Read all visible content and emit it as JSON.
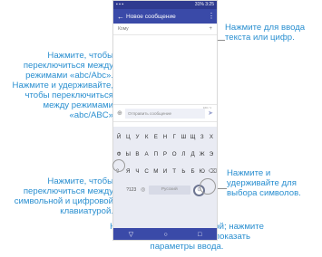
{
  "callouts": {
    "text_input": "Нажмите для ввода текста или цифр.",
    "abc_mode": "Нажмите, чтобы переключиться между режимами «abc/Abc». Нажмите и удерживайте, чтобы переключиться между режимами «abc/ABC»",
    "symbol_keyboard": "Нажмите, чтобы переключиться между символьной и цифровой клавиатурой.",
    "symbols": "Нажмите и удерживайте для выбора символов.",
    "comma": "Нажмите для ввода запятой; нажмите и удерживайте, чтобы показать параметры ввода."
  },
  "phone": {
    "status": {
      "time": "3:25",
      "battery": "31%"
    },
    "appbar": {
      "back_icon": "←",
      "title": "Новое сообщение",
      "menu_icon": "⋮"
    },
    "recipient": {
      "placeholder": "Кому",
      "add_icon": "+"
    },
    "compose": {
      "clip_icon": "⊕",
      "placeholder": "Отправить сообщение",
      "counter": "160 / 1",
      "send_icon": "➤"
    },
    "keyboard": {
      "row1": [
        "Й",
        "Ц",
        "У",
        "К",
        "Е",
        "Н",
        "Г",
        "Ш",
        "Щ",
        "З",
        "Х"
      ],
      "row2": [
        "Ф",
        "Ы",
        "В",
        "А",
        "П",
        "Р",
        "О",
        "Л",
        "Д",
        "Ж",
        "Э"
      ],
      "shift": "⇧",
      "row3": [
        "Я",
        "Ч",
        "С",
        "М",
        "И",
        "Т",
        "Ь",
        "Б",
        "Ю"
      ],
      "backspace": "⌫",
      "sym": "?123",
      "globe": "◎",
      "space": "Русский",
      "enter": "⊙"
    },
    "nav": {
      "back": "▽",
      "home": "○",
      "recents": "□"
    }
  }
}
